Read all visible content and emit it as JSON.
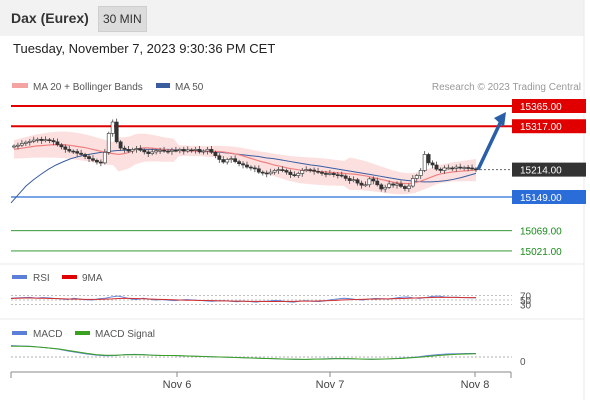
{
  "header": {
    "instrument": "Dax (Eurex)",
    "timeframe": "30 MIN"
  },
  "datetime": "Tuesday, November 7, 2023 9:30:36 PM CET",
  "legend": {
    "ma20_label": "MA 20 + Bollinger Bands",
    "ma50_label": "MA 50",
    "credit": "Research © 2023 Trading Central"
  },
  "rsi_legend": {
    "rsi": "RSI",
    "ma9": "9MA"
  },
  "macd_legend": {
    "macd": "MACD",
    "signal": "MACD Signal"
  },
  "colors": {
    "resistance": "#e00000",
    "support": "#2a6dd9",
    "target": "#1a8a1a",
    "last": "#333333",
    "arrow": "#2a5fa8",
    "ma20": "#f08080",
    "ma50": "#3a5da0",
    "rsi": "#5b7fd6",
    "macd": "#5b7fd6",
    "signal": "#3aa020"
  },
  "chart_data": [
    {
      "type": "candlestick",
      "title": "Dax (Eurex)",
      "x_ticks": [
        "Nov 6",
        "Nov 7",
        "Nov 8"
      ],
      "levels": [
        {
          "label": "15365.00",
          "value": 15365,
          "kind": "resistance"
        },
        {
          "label": "15317.00",
          "value": 15317,
          "kind": "resistance"
        },
        {
          "label": "15214.00",
          "value": 15214,
          "kind": "last"
        },
        {
          "label": "15149.00",
          "value": 15149,
          "kind": "support"
        },
        {
          "label": "15069.00",
          "value": 15069,
          "kind": "target"
        },
        {
          "label": "15021.00",
          "value": 15021,
          "kind": "target"
        }
      ],
      "close": [
        15270,
        15272,
        15276,
        15279,
        15281,
        15284,
        15286,
        15283,
        15285,
        15283,
        15280,
        15273,
        15268,
        15262,
        15258,
        15257,
        15253,
        15250,
        15245,
        15240,
        15236,
        15232,
        15230,
        15255,
        15300,
        15327,
        15280,
        15265,
        15262,
        15258,
        15262,
        15264,
        15260,
        15256,
        15252,
        15256,
        15259,
        15260,
        15258,
        15257,
        15260,
        15259,
        15262,
        15258,
        15261,
        15260,
        15262,
        15256,
        15258,
        15262,
        15255,
        15247,
        15238,
        15232,
        15238,
        15240,
        15233,
        15228,
        15225,
        15220,
        15218,
        15216,
        15208,
        15206,
        15204,
        15208,
        15212,
        15214,
        15212,
        15208,
        15202,
        15200,
        15205,
        15212,
        15214,
        15213,
        15210,
        15208,
        15205,
        15204,
        15205,
        15202,
        15201,
        15199,
        15193,
        15188,
        15190,
        15182,
        15177,
        15178,
        15192,
        15187,
        15178,
        15168,
        15172,
        15180,
        15177,
        15180,
        15174,
        15169,
        15175,
        15193,
        15200,
        15212,
        15250,
        15230,
        15225,
        15215,
        15212,
        15218,
        15218,
        15217,
        15220,
        15218,
        15219,
        15218,
        15216,
        15214
      ],
      "ma20": [
        15262,
        15264,
        15266,
        15268,
        15270,
        15271,
        15272,
        15273,
        15273,
        15273,
        15272,
        15270,
        15268,
        15266,
        15263,
        15260,
        15257,
        15254,
        15252,
        15250,
        15252,
        15255,
        15262,
        15265,
        15266,
        15265,
        15264,
        15262,
        15261,
        15260,
        15259,
        15259,
        15258,
        15258,
        15258,
        15257,
        15257,
        15257,
        15256,
        15254,
        15252,
        15249,
        15245,
        15241,
        15237,
        15233,
        15230,
        15226,
        15223,
        15220,
        15217,
        15215,
        15213,
        15212,
        15211,
        15210,
        15209,
        15208,
        15207,
        15206,
        15205,
        15204,
        15203,
        15201,
        15199,
        15196,
        15193,
        15190,
        15187,
        15184,
        15182,
        15181,
        15181,
        15183,
        15187,
        15192,
        15197,
        15202,
        15205,
        15207,
        15209,
        15210,
        15211,
        15212,
        15213
      ],
      "ma50": [
        15135,
        15155,
        15175,
        15190,
        15203,
        15215,
        15225,
        15233,
        15240,
        15245,
        15249,
        15252,
        15255,
        15257,
        15259,
        15260,
        15261,
        15262,
        15262,
        15262,
        15262,
        15262,
        15261,
        15261,
        15260,
        15259,
        15258,
        15256,
        15255,
        15253,
        15251,
        15249,
        15247,
        15245,
        15242,
        15240,
        15237,
        15234,
        15231,
        15228,
        15225,
        15223,
        15220,
        15217,
        15214,
        15211,
        15208,
        15205,
        15202,
        15199,
        15196,
        15193,
        15190,
        15188,
        15186,
        15185,
        15185,
        15186,
        15188,
        15191,
        15195,
        15200,
        15205
      ],
      "forecast_arrow": {
        "from": 15214,
        "to": 15365
      }
    },
    {
      "type": "line",
      "title": "RSI",
      "y_ticks": [
        70,
        50,
        30
      ],
      "series": [
        {
          "name": "RSI",
          "values": [
            58,
            60,
            61,
            62,
            59,
            61,
            60,
            57,
            55,
            52,
            58,
            54,
            51,
            50,
            56,
            58,
            64,
            68,
            62,
            55,
            52,
            58,
            54,
            50,
            52,
            49,
            47,
            50,
            52,
            50,
            48,
            46,
            44,
            46,
            47,
            44,
            42,
            45,
            43,
            40,
            44,
            45,
            48,
            46,
            42,
            40,
            45,
            47,
            44,
            43,
            46,
            52,
            55,
            58,
            56,
            52,
            50,
            55,
            57,
            56,
            54,
            58,
            62,
            64,
            60,
            57,
            61,
            66,
            68,
            64,
            62,
            63,
            61,
            60,
            60
          ]
        },
        {
          "name": "9MA",
          "values": [
            57,
            58,
            59,
            59,
            58,
            58,
            57,
            56,
            55,
            54,
            54,
            53,
            53,
            53,
            54,
            55,
            57,
            58,
            57,
            56,
            55,
            54,
            53,
            52,
            51,
            50,
            49,
            49,
            48,
            48,
            47,
            46,
            46,
            45,
            45,
            44,
            44,
            44,
            43,
            43,
            43,
            44,
            44,
            45,
            45,
            45,
            46,
            47,
            48,
            50,
            51,
            52,
            53,
            54,
            54,
            55,
            55,
            56,
            57,
            58,
            59,
            60,
            61,
            62,
            62,
            62,
            62,
            61,
            61,
            61
          ]
        }
      ]
    },
    {
      "type": "line",
      "title": "MACD",
      "y_ticks": [
        0
      ],
      "series": [
        {
          "name": "MACD",
          "values": [
            38,
            37,
            36,
            33,
            30,
            26,
            20,
            15,
            10,
            6,
            4,
            5,
            8,
            9,
            8,
            6,
            5,
            5,
            4,
            3,
            2,
            1,
            0,
            -1,
            -2,
            -3,
            -4,
            -5,
            -6,
            -7,
            -8,
            -8,
            -7,
            -6,
            -5,
            -5,
            -6,
            -7,
            -8,
            -7,
            -6,
            -4,
            -2,
            1,
            5,
            8,
            10,
            11,
            12,
            12
          ]
        },
        {
          "name": "MACD Signal",
          "values": [
            36,
            36,
            35,
            33,
            30,
            27,
            22,
            17,
            12,
            8,
            6,
            6,
            7,
            8,
            7,
            6,
            5,
            5,
            4,
            3,
            2,
            1,
            0,
            -1,
            -2,
            -3,
            -4,
            -5,
            -6,
            -7,
            -7,
            -8,
            -7,
            -7,
            -6,
            -6,
            -6,
            -7,
            -7,
            -7,
            -6,
            -5,
            -3,
            -1,
            2,
            5,
            7,
            9,
            10,
            11
          ]
        }
      ]
    }
  ]
}
